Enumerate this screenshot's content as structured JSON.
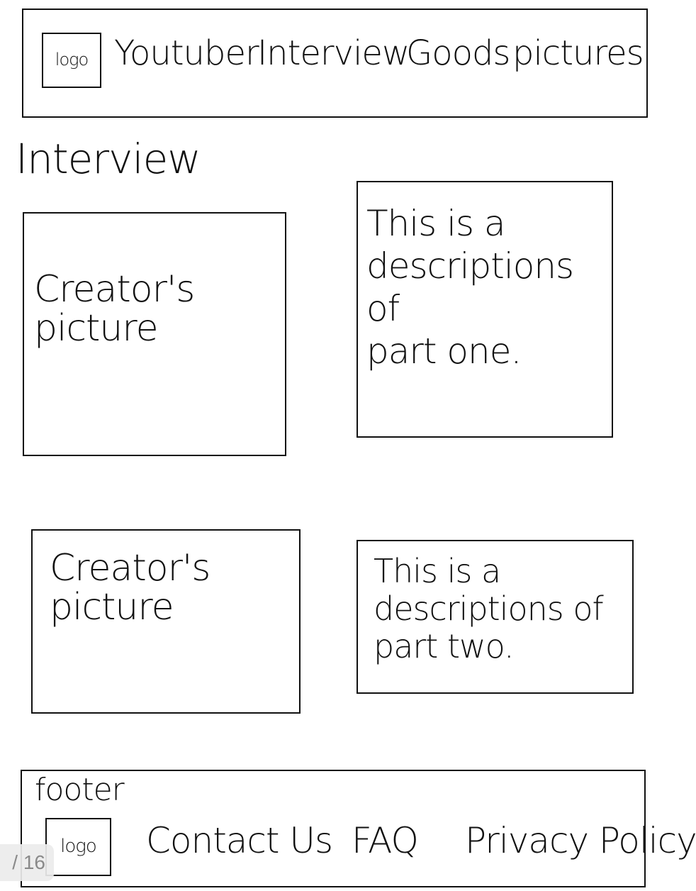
{
  "header": {
    "logo": "logo",
    "nav": [
      "Youtuber",
      "Interview",
      "Goods",
      "pictures"
    ]
  },
  "main": {
    "section_title": "Interview",
    "items": [
      {
        "picture_label": "Creator's\npicture",
        "description": "This is a\ndescriptions of\npart one."
      },
      {
        "picture_label": "Creator's\npicture",
        "description": "This is a\ndescriptions of\npart two."
      }
    ]
  },
  "footer": {
    "label": "footer",
    "logo": "logo",
    "links": [
      "Contact Us",
      "FAQ",
      "Privacy Policy"
    ]
  },
  "page_indicator": "/ 16"
}
